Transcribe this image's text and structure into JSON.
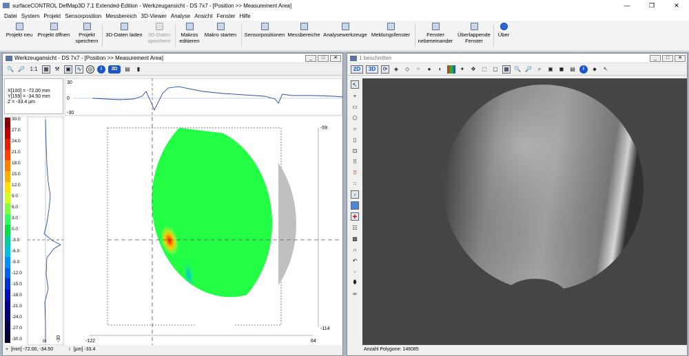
{
  "titlebar": {
    "title": "surfaceCONTROL DefMap3D 7.1 Extended-Edition - Werkzeugansicht - DS 7x7 - [Position >> Measurement Area]",
    "minimize": "—",
    "maximize": "❐",
    "close": "✕"
  },
  "menu": [
    "Datei",
    "System",
    "Projekt",
    "Sensorposition",
    "Messbereich",
    "3D-Viewer",
    "Analyse",
    "Ansicht",
    "Fenster",
    "Hilfe"
  ],
  "ribbon": [
    {
      "label": "Projekt neu",
      "icon": "new-project-icon",
      "enabled": true
    },
    {
      "label": "Projekt öffnen",
      "icon": "open-project-icon",
      "enabled": true
    },
    {
      "label": "Projekt\nspeichern",
      "icon": "save-project-icon",
      "enabled": true
    },
    {
      "label": "3D-Daten laden",
      "icon": "load-3d-icon",
      "enabled": true
    },
    {
      "label": "3D-Daten\nspeichern",
      "icon": "save-3d-icon",
      "enabled": false
    },
    {
      "label": "Makros\neditieren",
      "icon": "macro-edit-icon",
      "enabled": true
    },
    {
      "label": "Makro starten",
      "icon": "macro-run-icon",
      "enabled": true
    },
    {
      "label": "Sensorpositionen",
      "icon": "sensor-icon",
      "enabled": true
    },
    {
      "label": "Messbereiche",
      "icon": "measure-area-icon",
      "enabled": true
    },
    {
      "label": "Analysewerkzeuge",
      "icon": "analysis-icon",
      "enabled": true
    },
    {
      "label": "Meldungsfenster",
      "icon": "message-icon",
      "enabled": true
    },
    {
      "label": "Fenster\nnebeneinander",
      "icon": "tile-icon",
      "enabled": true
    },
    {
      "label": "Überlappende\nFenster",
      "icon": "cascade-icon",
      "enabled": true
    },
    {
      "label": "Über",
      "icon": "info-icon",
      "enabled": true
    }
  ],
  "left_window": {
    "title": "Werkzeugansicht - DS 7x7 - [Position >> Measurement Area]",
    "toolbar": {
      "ratio": "1:1",
      "view3d": "3D",
      "info": "i"
    },
    "readout": {
      "x": "X[100] = -72.00 mm",
      "y": "Y[159] = -34.50 mm",
      "z": "Z = -33.4 µm"
    },
    "profile_top_labels": {
      "max": "30",
      "zero": "0",
      "min": "-30"
    },
    "colorbar": [
      "30.0",
      "27.0",
      "24.0",
      "21.0",
      "18.0",
      "15.0",
      "12.0",
      "9.0",
      "6.0",
      "3.0",
      "0.0",
      "-3.0",
      "-6.0",
      "-9.0",
      "-12.0",
      "-15.0",
      "-18.0",
      "-21.0",
      "-24.0",
      "-27.0",
      "-30.0"
    ],
    "colorbar_colors": [
      "#8b0000",
      "#c00000",
      "#e02000",
      "#ff4000",
      "#ff8000",
      "#ffb000",
      "#ffe000",
      "#d0ff20",
      "#80ff40",
      "#30ff60",
      "#00e040",
      "#00d0a0",
      "#00c0e0",
      "#0090ff",
      "#0060f0",
      "#0030d0",
      "#0010b0",
      "#000090",
      "#000070",
      "#000050",
      "#000030"
    ],
    "profile_left_labels": {
      "zero": "0",
      "min": "-30",
      "max": "30"
    },
    "axis": {
      "xmin": "-122",
      "xmax": "64",
      "ytop": "-59",
      "ybottom": "-114"
    },
    "status": {
      "coords": "[mm] -72.00, -34.50",
      "value": "[µm] -33.4"
    }
  },
  "right_window": {
    "title": "1 beschnitten",
    "toolbar": {
      "view2d": "2D",
      "view3d": "3D",
      "info": "i"
    },
    "status": "Anzahl Polygone: 146085"
  }
}
